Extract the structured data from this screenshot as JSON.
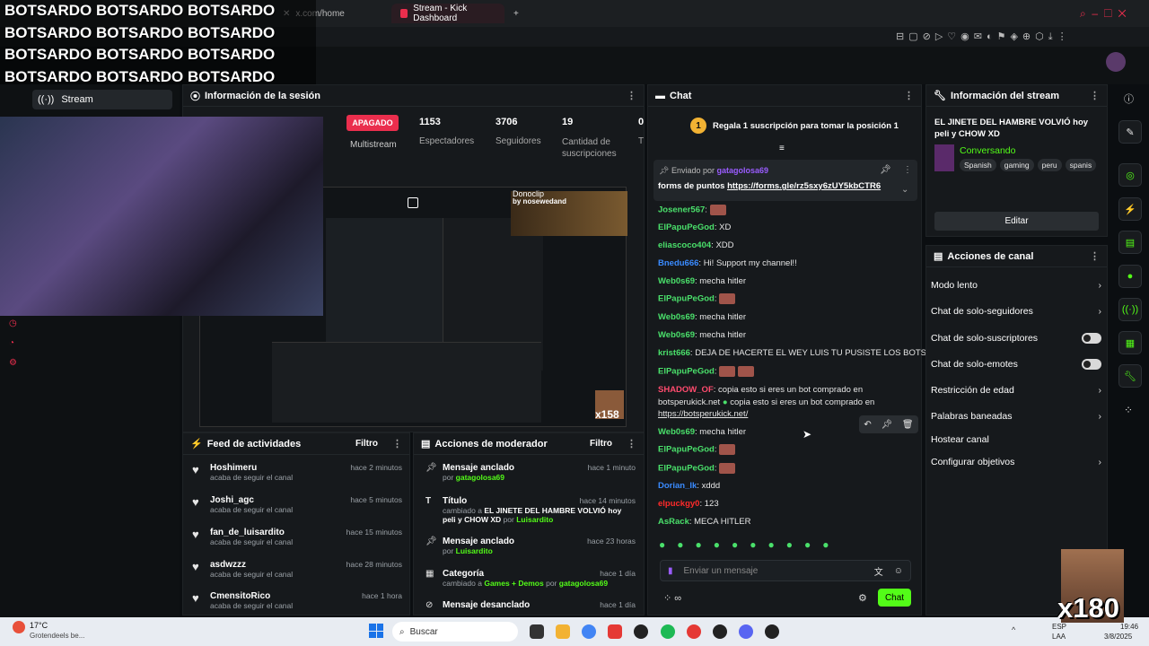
{
  "overlay": {
    "bot_lines": [
      "BOTSARDO BOTSARDO BOTSARDO",
      "BOTSARDO BOTSARDO BOTSARDO",
      "BOTSARDO BOTSARDO BOTSARDO",
      "BOTSARDO BOTSARDO BOTSARDO"
    ],
    "x_counter": "x180",
    "x_small": "x158"
  },
  "browser": {
    "tabs": [
      {
        "label": "x.com/home"
      },
      {
        "label": "Stream - Kick Dashboard"
      }
    ],
    "new_tab": "+"
  },
  "nav": {
    "stream_label": "Stream"
  },
  "session": {
    "title": "Información de la sesión",
    "status": "APAGADO",
    "status_sub": "Multistream",
    "stats": [
      {
        "value": "1153",
        "label": "Espectadores"
      },
      {
        "value": "3706",
        "label": "Seguidores"
      },
      {
        "value": "19",
        "label": "Cantidad de suscripciones"
      },
      {
        "value": "0",
        "label": "T"
      }
    ]
  },
  "preview": {
    "clip_title": "Donoclip",
    "clip_sub": "by nosewedand"
  },
  "activity": {
    "title": "Feed de actividades",
    "filter": "Filtro",
    "items": [
      {
        "name": "Hoshimeru",
        "sub": "acaba de seguir el canal",
        "time": "hace 2 minutos"
      },
      {
        "name": "Joshi_agc",
        "sub": "acaba de seguir el canal",
        "time": "hace 5 minutos"
      },
      {
        "name": "fan_de_luisardito",
        "sub": "acaba de seguir el canal",
        "time": "hace 15 minutos"
      },
      {
        "name": "asdwzzz",
        "sub": "acaba de seguir el canal",
        "time": "hace 28 minutos"
      },
      {
        "name": "CmensitoRico",
        "sub": "acaba de seguir el canal",
        "time": "hace 1 hora"
      }
    ]
  },
  "mod": {
    "title": "Acciones de moderador",
    "filter": "Filtro",
    "items": [
      {
        "title": "Mensaje anclado",
        "by": "por",
        "user": "gatagolosa69",
        "time": "hace 1 minuto"
      },
      {
        "title": "Título",
        "pre": "cambiado a",
        "val": "EL JINETE DEL HAMBRE VOLVIÓ",
        "rest": "hoy peli y CHOW XD",
        "by": "por",
        "user": "Luisardito",
        "time": "hace 14 minutos"
      },
      {
        "title": "Mensaje anclado",
        "by": "por",
        "user": "Luisardito",
        "time": "hace 23 horas"
      },
      {
        "title": "Categoría",
        "pre": "cambiado a",
        "val": "Games + Demos",
        "by": "por",
        "user": "gatagolosa69",
        "time": "hace 1 día"
      },
      {
        "title": "Mensaje desanclado",
        "time": "hace 1 día"
      }
    ]
  },
  "chat": {
    "title": "Chat",
    "gift": "Regala 1 suscripción para tomar la posición 1",
    "gift_rank": "1",
    "pinned_by": "Enviado por",
    "pinned_user": "gatagolosa69",
    "pinned_text": "forms de puntos",
    "pinned_link": "https://forms.gle/rz5sxy6zUY5kbCTR6",
    "messages": [
      {
        "user": "Josener567",
        "text": "",
        "color": "#4ae06b"
      },
      {
        "user": "ElPapuPeGod",
        "text": "XD",
        "color": "#4ae06b"
      },
      {
        "user": "eliascoco404",
        "text": "XDD",
        "color": "#4ae06b"
      },
      {
        "user": "Bnedu666",
        "text": "Hi! Support my channel!!",
        "color": "#3a8bff"
      },
      {
        "user": "Web0s69",
        "text": "mecha hitler",
        "color": "#4ae06b"
      },
      {
        "user": "ElPapuPeGod",
        "text": "",
        "color": "#4ae06b"
      },
      {
        "user": "Web0s69",
        "text": "mecha hitler",
        "color": "#4ae06b"
      },
      {
        "user": "Web0s69",
        "text": "mecha hitler",
        "color": "#4ae06b"
      },
      {
        "user": "krist666",
        "text": "DEJA DE HACERTE EL WEY LUIS TU PUSISTE LOS BOTS",
        "color": "#4ae06b"
      },
      {
        "user": "ElPapuPeGod",
        "text": "",
        "color": "#4ae06b"
      },
      {
        "user": "SHADOW_OF",
        "text": "copia esto si eres un bot comprado en",
        "color": "#ff4b6e"
      },
      {
        "user": "",
        "text": "botsperukick.net",
        "color": "#fff"
      },
      {
        "user": "",
        "text": "https://botsperukick.net/",
        "color": "#fff"
      },
      {
        "user": "Web0s69",
        "text": "mecha hitler",
        "color": "#4ae06b"
      },
      {
        "user": "ElPapuPeGod",
        "text": "",
        "color": "#4ae06b"
      },
      {
        "user": "ElPapuPeGod",
        "text": "",
        "color": "#4ae06b"
      },
      {
        "user": "Dorian_lk",
        "text": "xddd",
        "color": "#3a8bff"
      },
      {
        "user": "elpuckgy0",
        "text": "123",
        "color": "#ff2a2a"
      },
      {
        "user": "AsRack",
        "text": "MECA HITLER",
        "color": "#4ae06b"
      }
    ],
    "shadow_repeat": "copia esto si eres un bot comprado en",
    "input_placeholder": "Enviar un mensaje",
    "send": "Chat"
  },
  "stream_info": {
    "title": "Información del stream",
    "stream_title": "EL JINETE DEL HAMBRE VOLVIÓ",
    "stream_title_rest": "hoy peli y CHOW XD",
    "category": "Conversando",
    "tags": [
      "Spanish",
      "gaming",
      "peru",
      "spanis"
    ],
    "edit": "Editar"
  },
  "channel_actions": {
    "title": "Acciones de canal",
    "items": [
      {
        "label": "Modo lento",
        "kind": "chevron"
      },
      {
        "label": "Chat de solo-seguidores",
        "kind": "chevron"
      },
      {
        "label": "Chat de solo-suscriptores",
        "kind": "toggle"
      },
      {
        "label": "Chat de solo-emotes",
        "kind": "toggle"
      },
      {
        "label": "Restricción de edad",
        "kind": "chevron"
      },
      {
        "label": "Palabras baneadas",
        "kind": "chevron"
      },
      {
        "label": "Hostear canal",
        "kind": "none"
      },
      {
        "label": "Configurar objetivos",
        "kind": "chevron"
      }
    ]
  },
  "taskbar": {
    "weather": "17°C",
    "weather_sub": "Grotendeels be...",
    "search": "Buscar",
    "lang": "ESP",
    "lang2": "LAA",
    "time": "19:46",
    "date": "3/8/2025"
  },
  "colors": {
    "accent": "#53fc18",
    "live": "#ea2e4d"
  }
}
